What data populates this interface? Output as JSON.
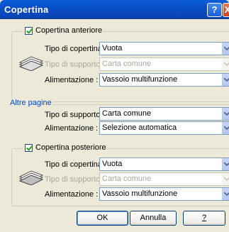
{
  "window": {
    "title": "Copertina",
    "help_glyph": "?",
    "close_glyph": "X"
  },
  "front_cover": {
    "checkbox_label": "Copertina anteriore",
    "checked": true,
    "icon": "paper-stack-icon",
    "cover_type_label": "Tipo di copertina :",
    "cover_type_value": "Vuota",
    "support_type_label": "Tipo di supporto :",
    "support_type_value": "Carta comune",
    "feed_label": "Alimentazione :",
    "feed_value": "Vassoio multifunzione"
  },
  "other_pages": {
    "title": "Altre pagine",
    "support_type_label": "Tipo di supporto :",
    "support_type_value": "Carta comune",
    "feed_label": "Alimentazione :",
    "feed_value": "Selezione automatica"
  },
  "back_cover": {
    "checkbox_label": "Copertina posteriore",
    "checked": true,
    "icon": "printed-stack-icon",
    "cover_type_label": "Tipo di copertina :",
    "cover_type_value": "Vuota",
    "support_type_label": "Tipo di supporto :",
    "support_type_value": "Carta comune",
    "feed_label": "Alimentazione :",
    "feed_value": "Vassoio multifunzione"
  },
  "buttons": {
    "ok": "OK",
    "cancel": "Annulla",
    "help": "?"
  },
  "colors": {
    "titlebar": "#0a4ec7",
    "dialog_bg": "#ece9d8",
    "group_title": "#0046d5",
    "disabled_text": "#aca899"
  }
}
